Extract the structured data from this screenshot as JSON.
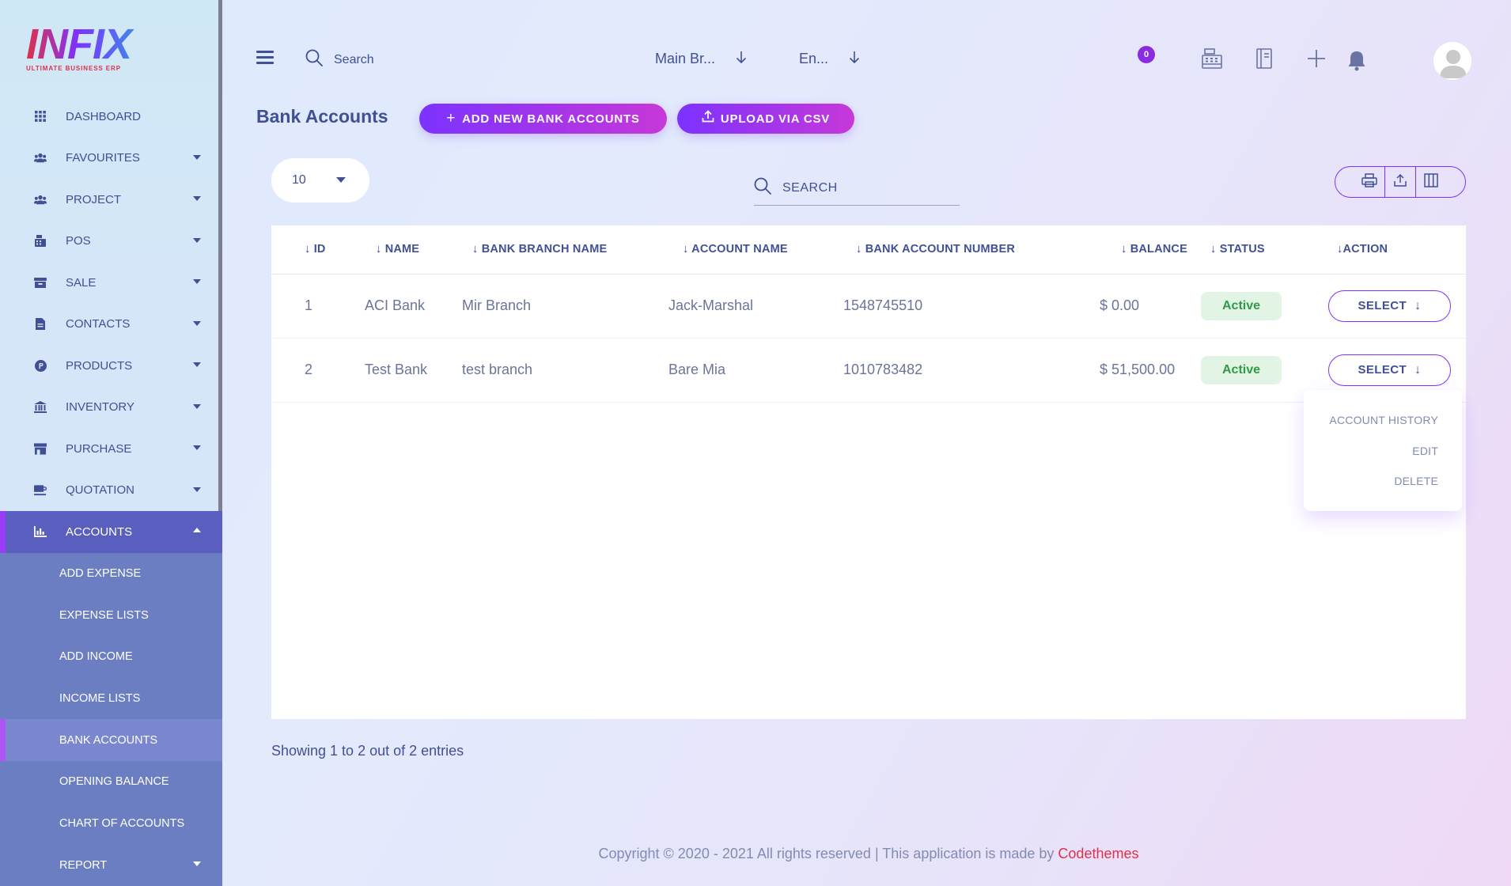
{
  "brand": {
    "logo_text": "INFIX",
    "tagline": "ULTIMATE BUSINESS ERP"
  },
  "sidebar": {
    "items": [
      {
        "label": "DASHBOARD",
        "icon": "grid-icon"
      },
      {
        "label": "FAVOURITES",
        "icon": "users-icon"
      },
      {
        "label": "PROJECT",
        "icon": "users-icon"
      },
      {
        "label": "POS",
        "icon": "pos-icon"
      },
      {
        "label": "SALE",
        "icon": "tray-icon"
      },
      {
        "label": "CONTACTS",
        "icon": "document-icon"
      },
      {
        "label": "PRODUCTS",
        "icon": "p-circle-icon"
      },
      {
        "label": "INVENTORY",
        "icon": "bank-icon"
      },
      {
        "label": "PURCHASE",
        "icon": "store-icon"
      },
      {
        "label": "QUOTATION",
        "icon": "coffee-icon"
      },
      {
        "label": "ACCOUNTS",
        "icon": "chart-icon"
      }
    ],
    "accounts_submenu": [
      {
        "label": "ADD EXPENSE"
      },
      {
        "label": "EXPENSE LISTS"
      },
      {
        "label": "ADD INCOME"
      },
      {
        "label": "INCOME LISTS"
      },
      {
        "label": "BANK ACCOUNTS"
      },
      {
        "label": "OPENING BALANCE"
      },
      {
        "label": "CHART OF ACCOUNTS"
      },
      {
        "label": "REPORT"
      }
    ]
  },
  "topbar": {
    "search_placeholder": "Search",
    "branch": "Main Br...",
    "language": "En...",
    "notification_count": "0"
  },
  "page": {
    "title": "Bank Accounts",
    "add_button": "ADD NEW BANK ACCOUNTS",
    "upload_button": "UPLOAD VIA CSV"
  },
  "table": {
    "page_length": "10",
    "search_placeholder": "SEARCH",
    "columns": [
      "ID",
      "NAME",
      "BANK BRANCH NAME",
      "ACCOUNT NAME",
      "BANK ACCOUNT NUMBER",
      "BALANCE",
      "STATUS",
      "ACTION"
    ],
    "rows": [
      {
        "id": "1",
        "name": "ACI Bank",
        "branch": "Mir Branch",
        "account_name": "Jack-Marshal",
        "account_number": "1548745510",
        "balance": "$ 0.00",
        "status": "Active",
        "action": "SELECT"
      },
      {
        "id": "2",
        "name": "Test Bank",
        "branch": "test branch",
        "account_name": "Bare Mia",
        "account_number": "1010783482",
        "balance": "$ 51,500.00",
        "status": "Active",
        "action": "SELECT"
      }
    ],
    "info": "Showing 1 to 2 out of 2 entries"
  },
  "action_menu": {
    "items": [
      "ACCOUNT HISTORY",
      "EDIT",
      "DELETE"
    ]
  },
  "footer": {
    "text": "Copyright © 2020 - 2021 All rights reserved | This application is made by",
    "brand": "Codethemes"
  },
  "colors": {
    "accent": "#7c32ff",
    "accent_end": "#c738d8",
    "text": "#415094",
    "status_active": "#2f9b47",
    "brand_link": "#e0314a"
  }
}
